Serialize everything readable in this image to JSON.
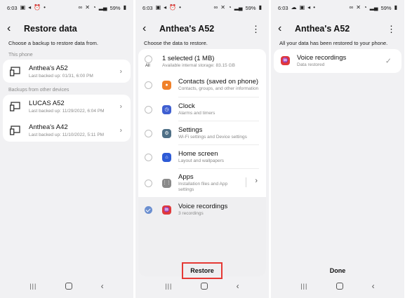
{
  "status": {
    "s1": {
      "time": "6:03",
      "battery": "59%"
    },
    "s2": {
      "time": "6:03",
      "battery": "59%"
    },
    "s3": {
      "time": "6:03",
      "battery": "59%"
    }
  },
  "screen1": {
    "title": "Restore data",
    "subtitle": "Choose a backup to restore data from.",
    "this_phone_label": "This phone",
    "this_phone": {
      "name": "Anthea's A52",
      "sub": "Last backed up: 01/31, 6:00 PM"
    },
    "other_label": "Backups from other devices",
    "other_devices": [
      {
        "name": "LUCAS A52",
        "sub": "Last backed up: 11/29/2022, 6:04 PM"
      },
      {
        "name": "Anthea's A42",
        "sub": "Last backed up: 11/10/2022, 5:11 PM"
      }
    ]
  },
  "screen2": {
    "title": "Anthea's A52",
    "subtitle": "Choose the data to restore.",
    "all": {
      "label": "All",
      "name": "1 selected (1 MB)",
      "sub": "Available internal storage: 83.15 GB"
    },
    "items": [
      {
        "name": "Contacts (saved on phone)",
        "sub": "Contacts, groups, and other information",
        "icon": "contacts-icon",
        "color": "#f0812a",
        "glyph": "●",
        "checked": false
      },
      {
        "name": "Clock",
        "sub": "Alarms and timers",
        "icon": "clock-icon",
        "color": "#3f5fd1",
        "glyph": "◷",
        "checked": false
      },
      {
        "name": "Settings",
        "sub": "Wi-Fi settings and Device settings",
        "icon": "settings-icon",
        "color": "#4e6f86",
        "glyph": "⚙",
        "checked": false
      },
      {
        "name": "Home screen",
        "sub": "Layout and wallpapers",
        "icon": "home-screen-icon",
        "color": "#2e5bd6",
        "glyph": "⌂",
        "checked": false
      },
      {
        "name": "Apps",
        "sub_line1": "Installation files and App",
        "sub_line2": "settings",
        "icon": "apps-icon",
        "color": "#8a8a8a",
        "glyph": "⋮⋮",
        "checked": false
      },
      {
        "name": "Voice recordings",
        "sub": "3 recordings",
        "icon": "voice-recordings-icon",
        "color": "#e0393b",
        "glyph": "♒",
        "checked": true
      }
    ],
    "restore_label": "Restore"
  },
  "screen3": {
    "title": "Anthea's A52",
    "subtitle": "All your data has been restored to your phone.",
    "item": {
      "name": "Voice recordings",
      "sub": "Data restored"
    },
    "done_label": "Done"
  },
  "colors": {
    "accent_check": "#6b8fd0",
    "highlight": "#e53935",
    "background": "#f1f1f3"
  }
}
